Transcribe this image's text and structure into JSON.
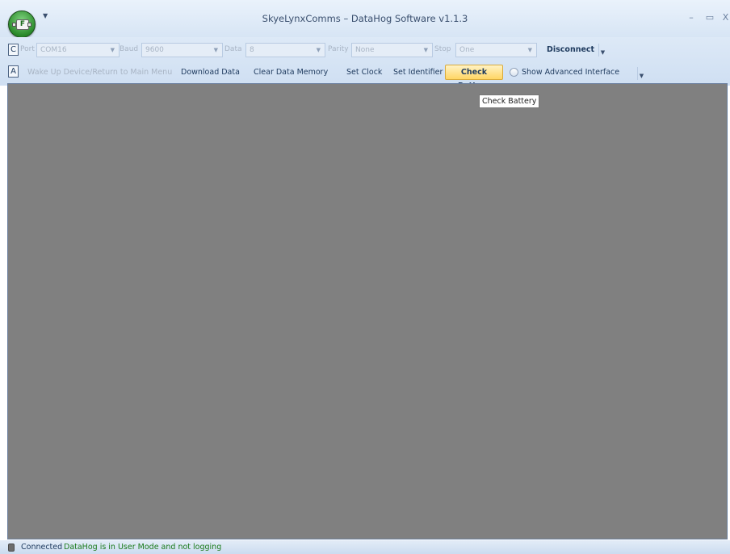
{
  "window": {
    "title": "SkyeLynxComms – DataHog Software v1.1.3",
    "app_badge_letter": "F",
    "min_glyph": "–",
    "max_glyph": "▭",
    "close_glyph": "X"
  },
  "connection_toolbar": {
    "grip_letter": "C",
    "port_label": "Port",
    "port_value": "COM16",
    "baud_label": "Baud",
    "baud_value": "9600",
    "data_label": "Data",
    "data_value": "8",
    "parity_label": "Parity",
    "parity_value": "None",
    "stop_label": "Stop",
    "stop_value": "One",
    "disconnect_label": "Disconnect"
  },
  "actions_toolbar": {
    "grip_letter": "A",
    "wake_up_label": "Wake Up Device/Return to Main Menu",
    "download_label": "Download Data",
    "clear_label": "Clear Data Memory",
    "set_clock_label": "Set Clock",
    "set_identifier_label": "Set Identifier",
    "check_battery_label": "Check Battery",
    "advanced_label": "Show Advanced Interface",
    "advanced_checked": false
  },
  "tooltip": {
    "text": "Check Battery"
  },
  "status": {
    "connection": "Connected",
    "mode": "DataHog is in User Mode and not logging"
  },
  "colors": {
    "workspace": "#808080",
    "ribbon": "#d7e5f5",
    "highlight": "#ffd564",
    "status_ok": "#1a7a1a"
  }
}
